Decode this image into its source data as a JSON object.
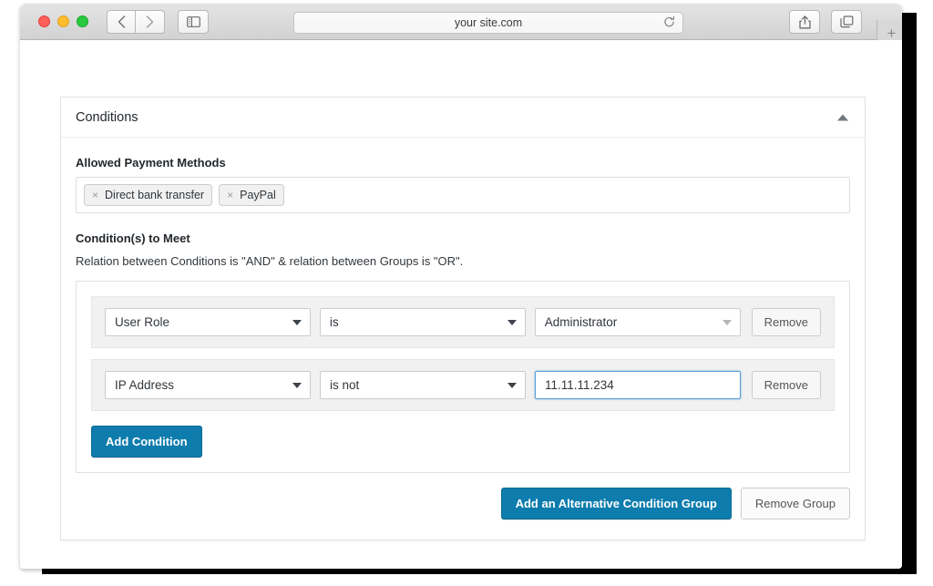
{
  "browser": {
    "url": "your site.com",
    "reload_icon": "reload-icon",
    "back_icon": "chevron-left-icon",
    "forward_icon": "chevron-right-icon",
    "sidebar_icon": "sidebar-icon",
    "share_icon": "share-icon",
    "tabs_icon": "tabs-icon",
    "new_tab_label": "+"
  },
  "panel": {
    "title": "Conditions",
    "toggle_icon": "chevron-up-icon"
  },
  "payment_methods": {
    "label": "Allowed Payment Methods",
    "tags": [
      {
        "remove": "×",
        "label": "Direct bank transfer"
      },
      {
        "remove": "×",
        "label": "PayPal"
      }
    ]
  },
  "conditions": {
    "label": "Condition(s) to Meet",
    "note": "Relation between Conditions is \"AND\" & relation between Groups is \"OR\".",
    "rows": [
      {
        "field": "User Role",
        "operator": "is",
        "value": "Administrator",
        "value_type": "select",
        "remove_label": "Remove"
      },
      {
        "field": "IP Address",
        "operator": "is not",
        "value": "11.11.11.234",
        "value_type": "text",
        "remove_label": "Remove"
      }
    ],
    "add_condition_label": "Add Condition",
    "add_group_label": "Add an Alternative Condition Group",
    "remove_group_label": "Remove Group"
  },
  "colors": {
    "primary": "#0e7cad",
    "focus_border": "#5b9dd9",
    "row_bg": "#f1f1f1"
  }
}
